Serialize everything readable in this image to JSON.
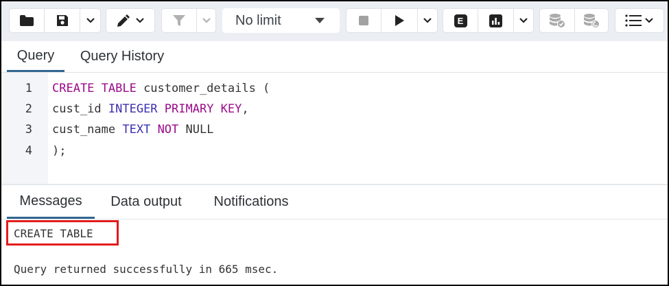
{
  "toolbar": {
    "buttons": {
      "open_file": "folder-icon",
      "save": "save-icon",
      "save_menu": "chevron-down-icon",
      "edit": "pen-icon",
      "filter": "filter-icon",
      "filter_menu": "chevron-down-icon",
      "stop": "stop-icon",
      "execute": "play-icon",
      "execute_menu": "chevron-down-icon",
      "explain": "explain-icon",
      "explain_analyze": "chart-icon",
      "explain_menu": "chevron-down-icon",
      "commit": "database-check-icon",
      "rollback": "database-undo-icon",
      "macros": "list-icon"
    },
    "limit_select": {
      "value": "No limit"
    },
    "explain_label": "E"
  },
  "query_tabs": [
    {
      "label": "Query",
      "active": true
    },
    {
      "label": "Query History",
      "active": false
    }
  ],
  "editor": {
    "line_numbers": [
      "1",
      "2",
      "3",
      "4"
    ],
    "lines": [
      [
        {
          "text": "CREATE TABLE",
          "kind": "keyword"
        },
        {
          "text": " customer_details (",
          "kind": "plain"
        }
      ],
      [
        {
          "text": "cust_id ",
          "kind": "plain"
        },
        {
          "text": "INTEGER",
          "kind": "type"
        },
        {
          "text": " ",
          "kind": "plain"
        },
        {
          "text": "PRIMARY KEY",
          "kind": "keyword"
        },
        {
          "text": ",",
          "kind": "plain"
        }
      ],
      [
        {
          "text": "cust_name ",
          "kind": "plain"
        },
        {
          "text": "TEXT",
          "kind": "type"
        },
        {
          "text": " ",
          "kind": "plain"
        },
        {
          "text": "NOT",
          "kind": "keyword"
        },
        {
          "text": " NULL",
          "kind": "plain"
        }
      ],
      [
        {
          "text": ");",
          "kind": "plain"
        }
      ]
    ]
  },
  "result_tabs": [
    {
      "label": "Messages",
      "active": true
    },
    {
      "label": "Data output",
      "active": false
    },
    {
      "label": "Notifications",
      "active": false
    }
  ],
  "messages": {
    "command": "CREATE TABLE",
    "status": "Query returned successfully in 665 msec."
  },
  "colors": {
    "keyword": "#9a0a8a",
    "type": "#3a2fb0",
    "active_tab_underline": "#326690",
    "highlight_box": "#e31b1b"
  }
}
